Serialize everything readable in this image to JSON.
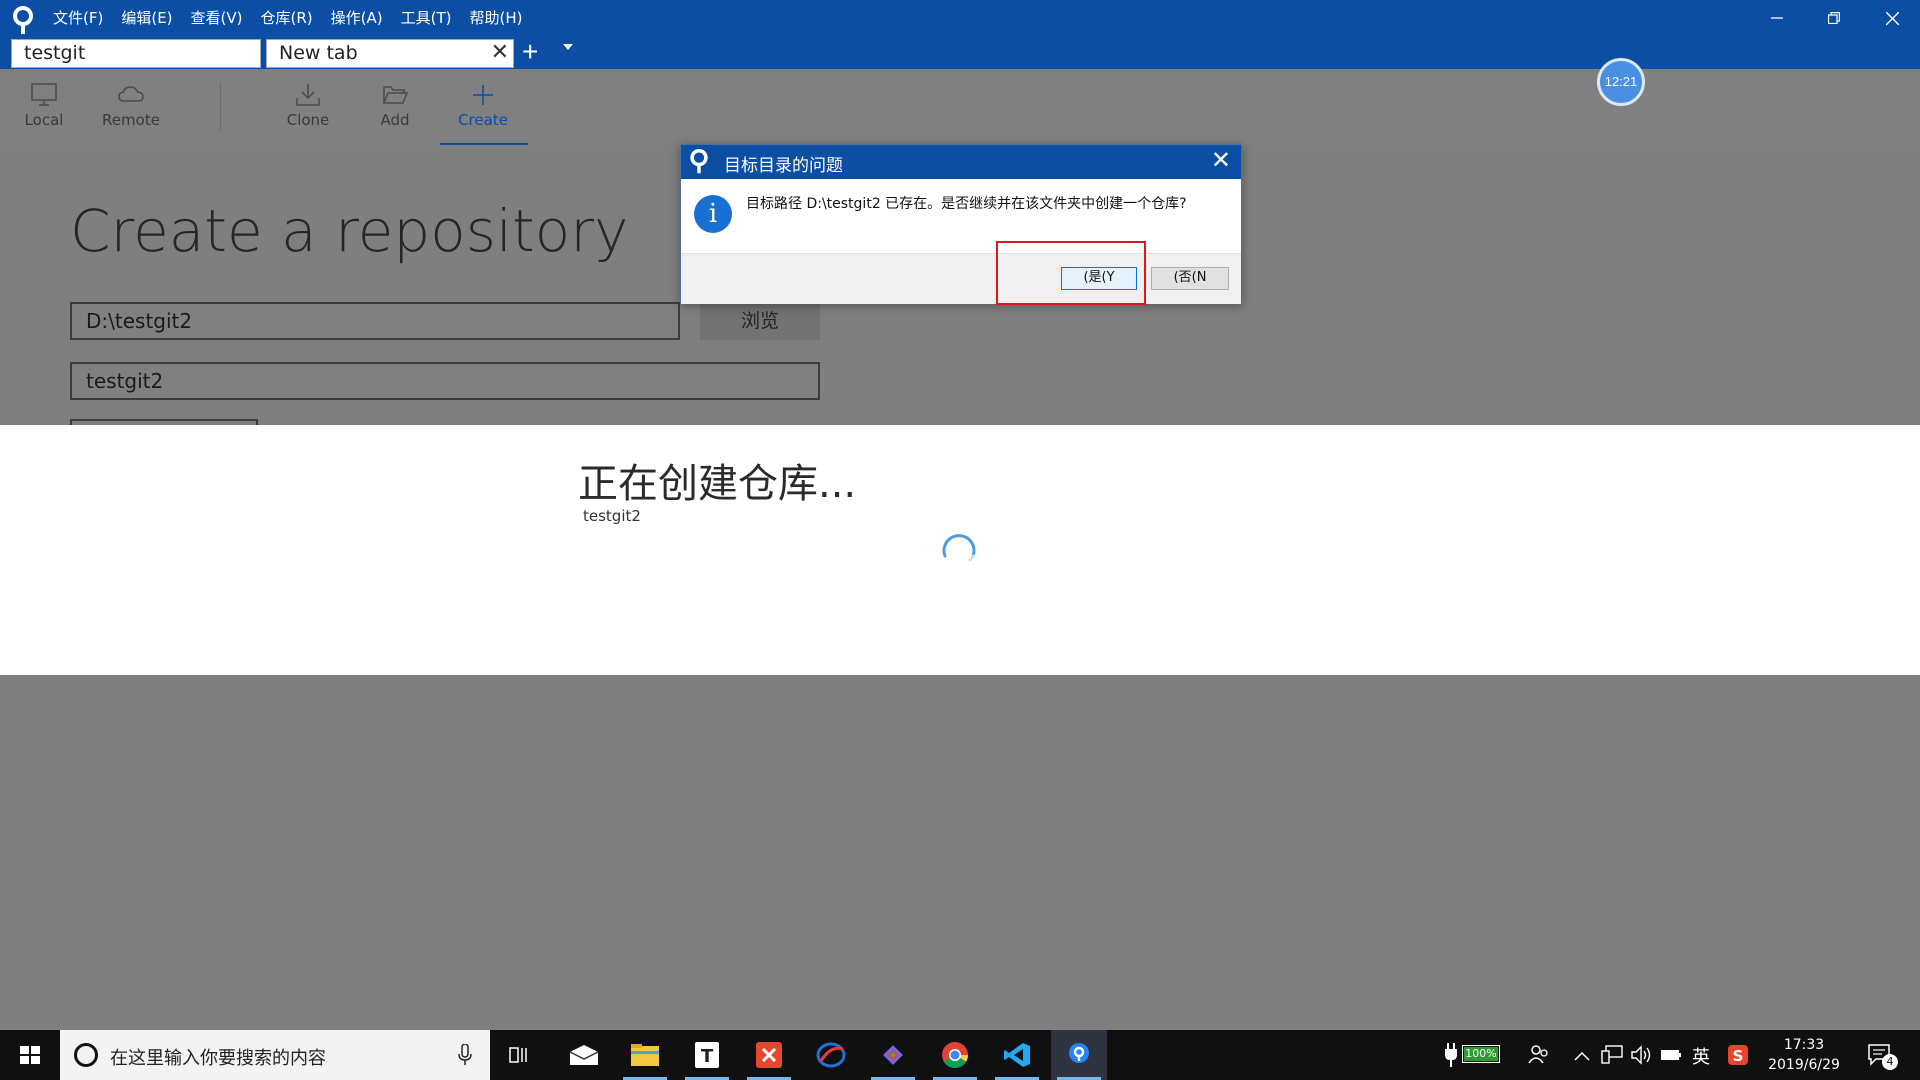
{
  "menu": {
    "items": [
      "文件(F)",
      "编辑(E)",
      "查看(V)",
      "仓库(R)",
      "操作(A)",
      "工具(T)",
      "帮助(H)"
    ]
  },
  "tabs": [
    {
      "label": "testgit"
    },
    {
      "label": "New tab"
    }
  ],
  "toolbar": {
    "local": "Local",
    "remote": "Remote",
    "clone": "Clone",
    "add": "Add",
    "create": "Create"
  },
  "main": {
    "title": "Create a repository",
    "path_value": "D:\\testgit2",
    "name_value": "testgit2",
    "browse_label": "浏览"
  },
  "progress": {
    "title": "正在创建仓库...",
    "subtitle": "testgit2"
  },
  "time_bubble": "12:21",
  "dialog": {
    "title": "目标目录的问题",
    "message": "目标路径 D:\\testgit2 已存在。是否继续并在该文件夹中创建一个仓库?",
    "yes_label": "(是(Y",
    "no_label": "(否(N"
  },
  "taskbar": {
    "search_placeholder": "在这里输入你要搜索的内容",
    "battery": "100%",
    "ime": "英",
    "time": "17:33",
    "date": "2019/6/29",
    "notifications": "4"
  },
  "colors": {
    "titlebar": "#0b4ea3",
    "overlay": "#7f7f7f",
    "highlight": "#e0141e",
    "info": "#1a6fd2"
  }
}
